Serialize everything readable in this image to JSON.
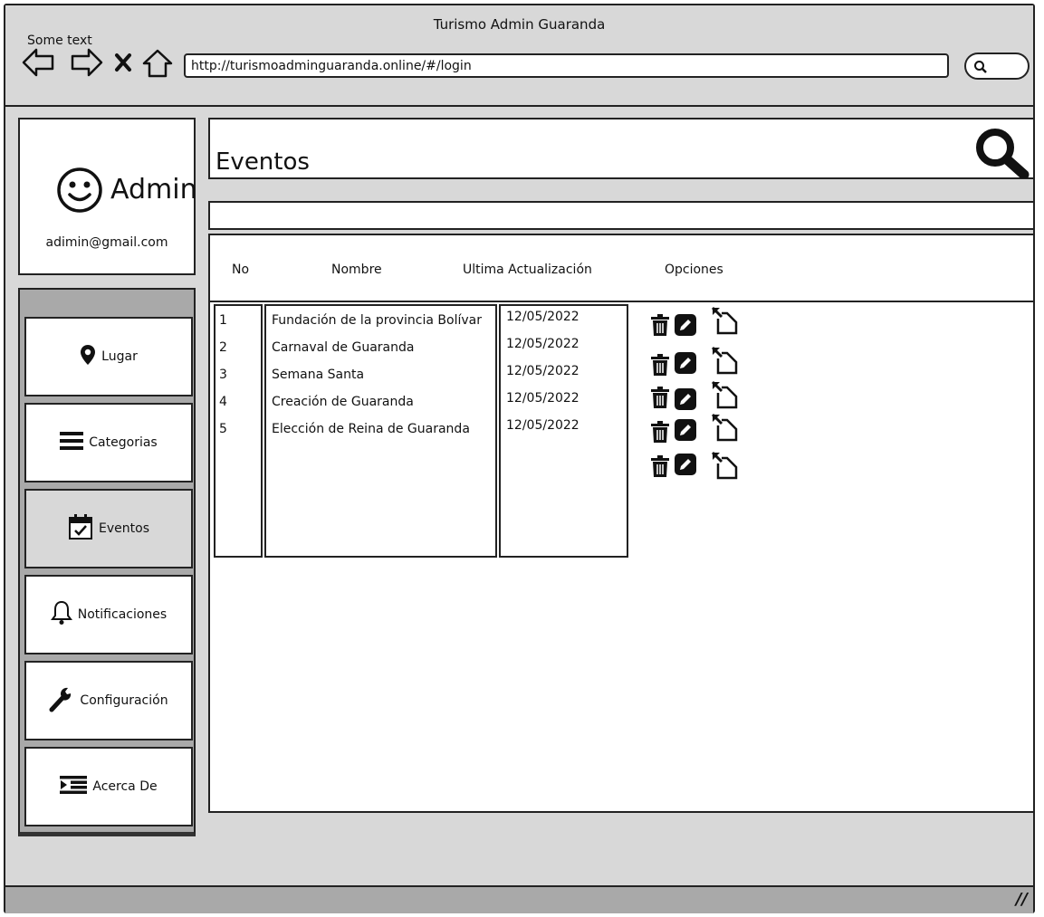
{
  "window": {
    "title": "Turismo Admin Guaranda",
    "some_text": "Some text"
  },
  "browser": {
    "url": "http://turismoadminguaranda.online/#/login"
  },
  "profile": {
    "name": "Admin",
    "email": "adimin@gmail.com"
  },
  "sidebar": {
    "items": [
      {
        "label": "Lugar",
        "icon": "location-pin-icon"
      },
      {
        "label": "Categorias",
        "icon": "hamburger-icon"
      },
      {
        "label": "Eventos",
        "icon": "calendar-check-icon",
        "active": true
      },
      {
        "label": "Notificaciones",
        "icon": "bell-icon"
      },
      {
        "label": "Configuración",
        "icon": "wrench-icon"
      },
      {
        "label": "Acerca De",
        "icon": "indent-list-icon"
      }
    ]
  },
  "main": {
    "title": "Eventos",
    "table": {
      "headers": [
        "No",
        "Nombre",
        "Ultima Actualización",
        "Opciones"
      ],
      "rows": [
        {
          "no": "1",
          "nombre": "Fundación de la provincia Bolívar",
          "fecha": "12/05/2022"
        },
        {
          "no": "2",
          "nombre": "Carnaval de Guaranda",
          "fecha": "12/05/2022"
        },
        {
          "no": "3",
          "nombre": "Semana Santa",
          "fecha": "12/05/2022"
        },
        {
          "no": "4",
          "nombre": "Creación de Guaranda",
          "fecha": "12/05/2022"
        },
        {
          "no": "5",
          "nombre": "Elección de Reina de Guaranda",
          "fecha": "12/05/2022"
        }
      ]
    }
  }
}
